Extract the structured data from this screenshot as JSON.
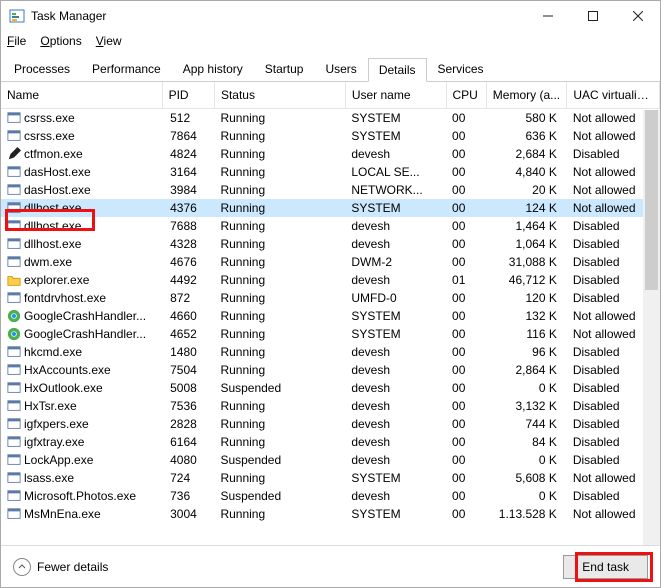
{
  "window": {
    "title": "Task Manager"
  },
  "menu": {
    "file": "File",
    "options": "Options",
    "view": "View"
  },
  "tabs": {
    "processes": "Processes",
    "performance": "Performance",
    "app_history": "App history",
    "startup": "Startup",
    "users": "Users",
    "details": "Details",
    "services": "Services"
  },
  "columns": {
    "name": "Name",
    "pid": "PID",
    "status": "Status",
    "user": "User name",
    "cpu": "CPU",
    "memory": "Memory (a...",
    "uac": "UAC virtualizat..."
  },
  "rows": [
    {
      "icon": "app",
      "name": "csrss.exe",
      "pid": "512",
      "status": "Running",
      "user": "SYSTEM",
      "cpu": "00",
      "mem": "580 K",
      "uac": "Not allowed"
    },
    {
      "icon": "app",
      "name": "csrss.exe",
      "pid": "7864",
      "status": "Running",
      "user": "SYSTEM",
      "cpu": "00",
      "mem": "636 K",
      "uac": "Not allowed"
    },
    {
      "icon": "pen",
      "name": "ctfmon.exe",
      "pid": "4824",
      "status": "Running",
      "user": "devesh",
      "cpu": "00",
      "mem": "2,684 K",
      "uac": "Disabled"
    },
    {
      "icon": "app",
      "name": "dasHost.exe",
      "pid": "3164",
      "status": "Running",
      "user": "LOCAL SE...",
      "cpu": "00",
      "mem": "4,840 K",
      "uac": "Not allowed"
    },
    {
      "icon": "app",
      "name": "dasHost.exe",
      "pid": "3984",
      "status": "Running",
      "user": "NETWORK...",
      "cpu": "00",
      "mem": "20 K",
      "uac": "Not allowed"
    },
    {
      "icon": "app",
      "name": "dllhost.exe",
      "pid": "4376",
      "status": "Running",
      "user": "SYSTEM",
      "cpu": "00",
      "mem": "124 K",
      "uac": "Not allowed",
      "selected": true
    },
    {
      "icon": "app",
      "name": "dllhost.exe",
      "pid": "7688",
      "status": "Running",
      "user": "devesh",
      "cpu": "00",
      "mem": "1,464 K",
      "uac": "Disabled"
    },
    {
      "icon": "app",
      "name": "dllhost.exe",
      "pid": "4328",
      "status": "Running",
      "user": "devesh",
      "cpu": "00",
      "mem": "1,064 K",
      "uac": "Disabled"
    },
    {
      "icon": "app",
      "name": "dwm.exe",
      "pid": "4676",
      "status": "Running",
      "user": "DWM-2",
      "cpu": "00",
      "mem": "31,088 K",
      "uac": "Disabled"
    },
    {
      "icon": "folder",
      "name": "explorer.exe",
      "pid": "4492",
      "status": "Running",
      "user": "devesh",
      "cpu": "01",
      "mem": "46,712 K",
      "uac": "Disabled"
    },
    {
      "icon": "app",
      "name": "fontdrvhost.exe",
      "pid": "872",
      "status": "Running",
      "user": "UMFD-0",
      "cpu": "00",
      "mem": "120 K",
      "uac": "Disabled"
    },
    {
      "icon": "chrome",
      "name": "GoogleCrashHandler...",
      "pid": "4660",
      "status": "Running",
      "user": "SYSTEM",
      "cpu": "00",
      "mem": "132 K",
      "uac": "Not allowed"
    },
    {
      "icon": "chrome",
      "name": "GoogleCrashHandler...",
      "pid": "4652",
      "status": "Running",
      "user": "SYSTEM",
      "cpu": "00",
      "mem": "116 K",
      "uac": "Not allowed"
    },
    {
      "icon": "app",
      "name": "hkcmd.exe",
      "pid": "1480",
      "status": "Running",
      "user": "devesh",
      "cpu": "00",
      "mem": "96 K",
      "uac": "Disabled"
    },
    {
      "icon": "app",
      "name": "HxAccounts.exe",
      "pid": "7504",
      "status": "Running",
      "user": "devesh",
      "cpu": "00",
      "mem": "2,864 K",
      "uac": "Disabled"
    },
    {
      "icon": "app",
      "name": "HxOutlook.exe",
      "pid": "5008",
      "status": "Suspended",
      "user": "devesh",
      "cpu": "00",
      "mem": "0 K",
      "uac": "Disabled"
    },
    {
      "icon": "app",
      "name": "HxTsr.exe",
      "pid": "7536",
      "status": "Running",
      "user": "devesh",
      "cpu": "00",
      "mem": "3,132 K",
      "uac": "Disabled"
    },
    {
      "icon": "app",
      "name": "igfxpers.exe",
      "pid": "2828",
      "status": "Running",
      "user": "devesh",
      "cpu": "00",
      "mem": "744 K",
      "uac": "Disabled"
    },
    {
      "icon": "app",
      "name": "igfxtray.exe",
      "pid": "6164",
      "status": "Running",
      "user": "devesh",
      "cpu": "00",
      "mem": "84 K",
      "uac": "Disabled"
    },
    {
      "icon": "app",
      "name": "LockApp.exe",
      "pid": "4080",
      "status": "Suspended",
      "user": "devesh",
      "cpu": "00",
      "mem": "0 K",
      "uac": "Disabled"
    },
    {
      "icon": "app",
      "name": "lsass.exe",
      "pid": "724",
      "status": "Running",
      "user": "SYSTEM",
      "cpu": "00",
      "mem": "5,608 K",
      "uac": "Not allowed"
    },
    {
      "icon": "app",
      "name": "Microsoft.Photos.exe",
      "pid": "736",
      "status": "Suspended",
      "user": "devesh",
      "cpu": "00",
      "mem": "0 K",
      "uac": "Disabled"
    },
    {
      "icon": "app",
      "name": "MsMnEna.exe",
      "pid": "3004",
      "status": "Running",
      "user": "SYSTEM",
      "cpu": "00",
      "mem": "1.13.528 K",
      "uac": "Not allowed"
    }
  ],
  "footer": {
    "fewer": "Fewer details",
    "end": "End task"
  },
  "icons": {
    "app": "<svg viewBox='0 0 16 16'><rect x='1' y='2' width='14' height='11' fill='#fff' stroke='#5b7aa8'/><rect x='1' y='2' width='14' height='3' fill='#5b7aa8'/></svg>",
    "pen": "<svg viewBox='0 0 16 16'><path d='M2 14 L4 8 L12 0 L16 4 L8 12 Z' fill='#222'/></svg>",
    "folder": "<svg viewBox='0 0 16 16'><path d='M1 4h5l1 2h8v8H1z' fill='#ffcc4d' stroke='#cc9a00'/></svg>",
    "chrome": "<svg viewBox='0 0 16 16'><circle cx='8' cy='8' r='7' fill='#4caf50'/><circle cx='8' cy='8' r='3.2' fill='#fff'/><circle cx='8' cy='8' r='2.4' fill='#2196f3'/></svg>"
  }
}
